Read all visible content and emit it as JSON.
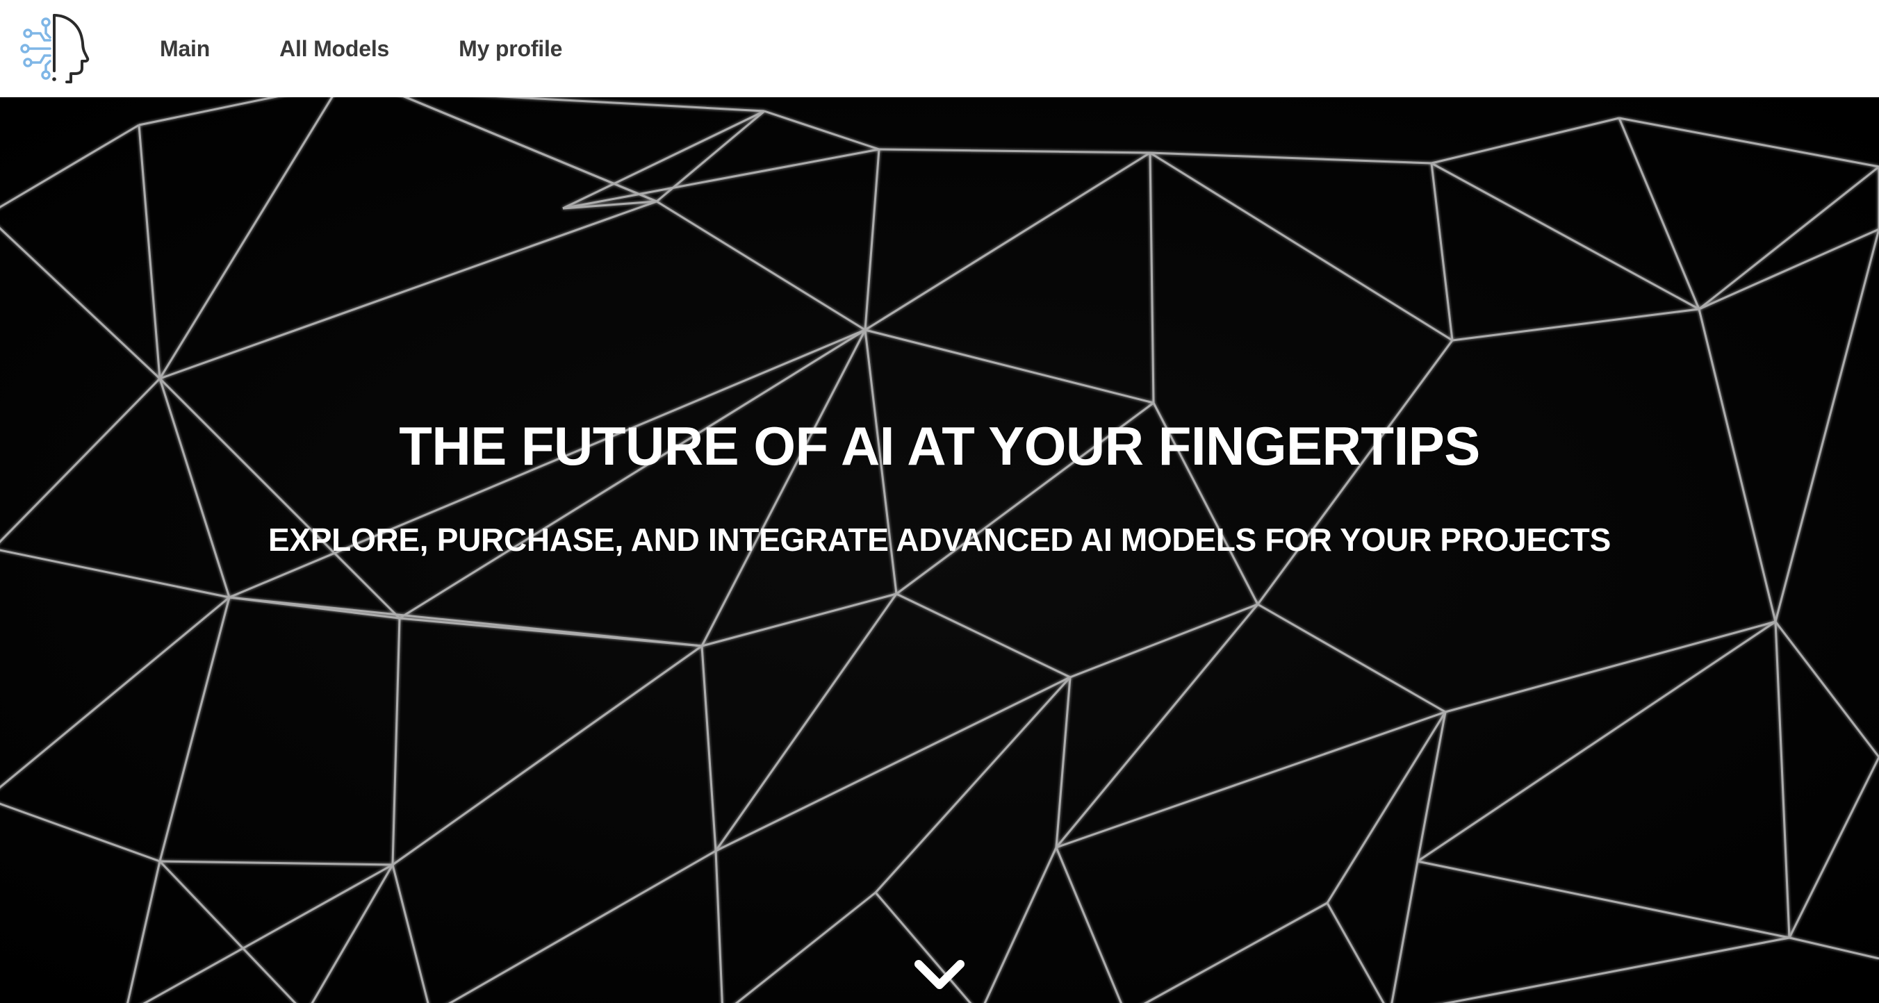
{
  "nav": {
    "logo_icon": "ai-head-circuit-logo",
    "links": [
      "Main",
      "All Models",
      "My profile"
    ]
  },
  "hero": {
    "title": "THE FUTURE OF AI AT YOUR FINGERTIPS",
    "subtitle": "EXPLORE, PURCHASE, AND INTEGRATE ADVANCED AI MODELS FOR YOUR PROJECTS",
    "background": "triangle-mesh-network",
    "scroll_icon": "chevron-down-icon"
  },
  "colors": {
    "nav_bg": "#ffffff",
    "nav_text": "#3a3a3a",
    "hero_bg": "#030303",
    "hero_text": "#ffffff",
    "logo_blue": "#7fb6e6",
    "logo_dark": "#2b2b2b",
    "mesh_line": "#cfcfcf"
  }
}
